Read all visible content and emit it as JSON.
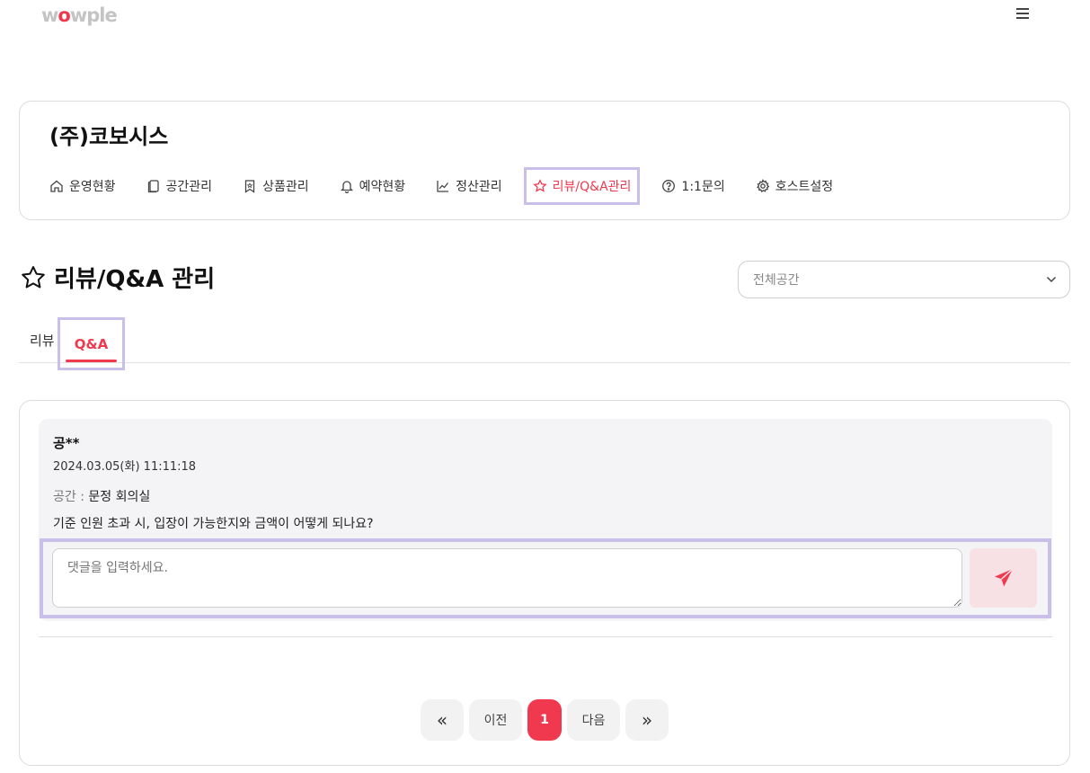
{
  "header": {
    "logo_text_pre": "w",
    "logo_text_o": "o",
    "logo_text_post": "wple",
    "menu_icon": "hamburger-icon"
  },
  "host": {
    "name": "(주)코보시스",
    "nav": [
      {
        "label": "운영현황",
        "icon": "home-icon"
      },
      {
        "label": "공간관리",
        "icon": "copy-icon"
      },
      {
        "label": "상품관리",
        "icon": "bookmark-icon"
      },
      {
        "label": "예약현황",
        "icon": "bell-icon"
      },
      {
        "label": "정산관리",
        "icon": "chart-line-icon"
      },
      {
        "label": "리뷰/Q&A관리",
        "icon": "star-icon",
        "active": true
      },
      {
        "label": "1:1문의",
        "icon": "help-circle-icon"
      },
      {
        "label": "호스트설정",
        "icon": "gear-icon"
      }
    ]
  },
  "page": {
    "title": "리뷰/Q&A 관리",
    "space_select": "전체공간"
  },
  "tabs": {
    "review": "리뷰",
    "qa": "Q&A"
  },
  "qa": {
    "author": "공**",
    "date": "2024.03.05(화) 11:11:18",
    "space_label": "공간 : ",
    "space_value": "문정 회의실",
    "question": "기준 인원 초과 시, 입장이 가능한지와 금액이 어떻게 되나요?",
    "reply_placeholder": "댓글을 입력하세요."
  },
  "pagination": {
    "first": "«",
    "prev": "이전",
    "current": "1",
    "next": "다음",
    "last": "»"
  },
  "colors": {
    "accent": "#f0394f",
    "highlight_border": "#c9bfe8"
  }
}
